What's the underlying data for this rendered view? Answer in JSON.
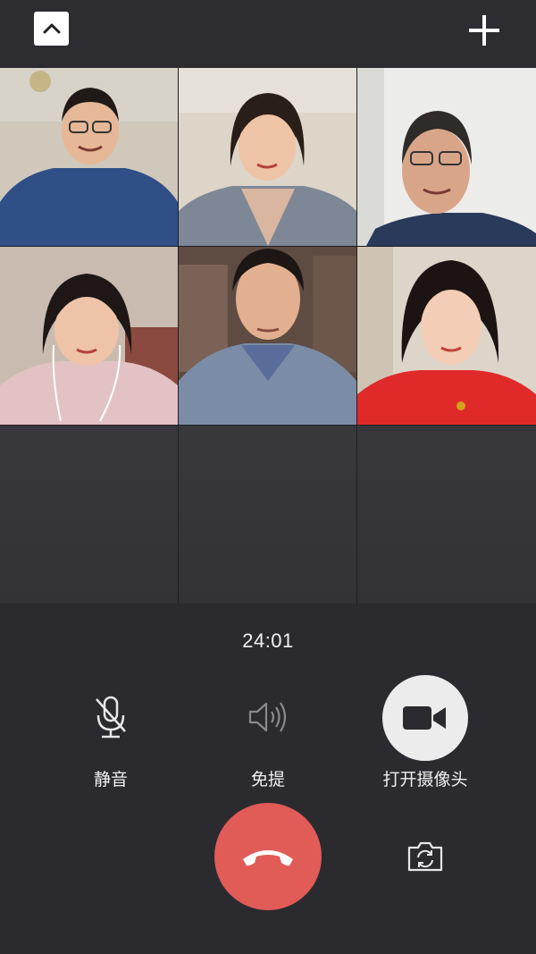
{
  "header": {
    "collapse_icon": "chevron-up-icon",
    "add_icon": "plus-icon"
  },
  "participants": [
    {
      "name": "participant-1",
      "background": "#c9c3b6",
      "shirt": "#2f4f86"
    },
    {
      "name": "participant-2",
      "background": "#d9d2c4",
      "shirt": "#7d8796"
    },
    {
      "name": "participant-3",
      "background": "#e8e8e6",
      "shirt": "#2a3a5a"
    },
    {
      "name": "participant-4",
      "background": "#c7b8ad",
      "shirt": "#e3c2c4"
    },
    {
      "name": "participant-5",
      "background": "#6d5a50",
      "shirt": "#7b8ca6"
    },
    {
      "name": "participant-6",
      "background": "#d9d0c6",
      "shirt": "#e02a2a"
    }
  ],
  "call": {
    "timer": "24:01"
  },
  "controls": {
    "mute_label": "静音",
    "speaker_label": "免提",
    "camera_label": "打开摄像头"
  },
  "colors": {
    "background": "#2b2b2f",
    "hangup": "#e15b57",
    "camera_button": "#ececec"
  }
}
